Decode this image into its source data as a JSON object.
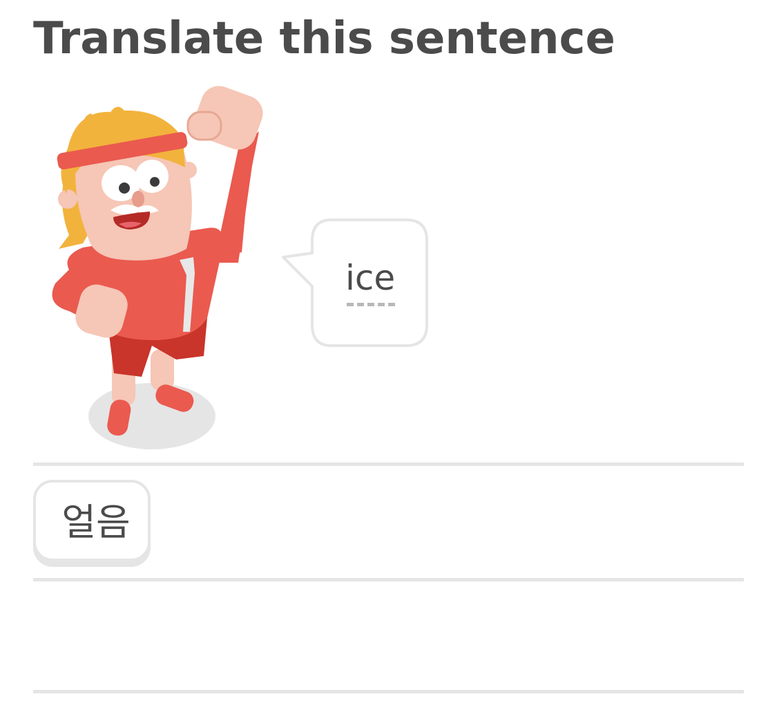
{
  "header": {
    "title": "Translate this sentence"
  },
  "prompt": {
    "bubble_word": "ice",
    "character_icon": "character-with-headband-icon"
  },
  "answer": {
    "selected_words": [
      "얼음"
    ]
  },
  "colors": {
    "text": "#4b4b4b",
    "border": "#e5e5e5",
    "character_shirt": "#ea5a4f",
    "character_hair": "#f2b33d",
    "character_skin": "#f6c6b6"
  }
}
